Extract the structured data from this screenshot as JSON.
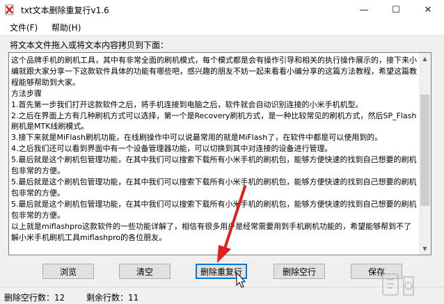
{
  "window": {
    "title": "txt文本删除重复行v1.6",
    "controls": {
      "minimize": "—",
      "maximize": "☐",
      "close": "✕"
    }
  },
  "menu": {
    "file": "文件(F)",
    "help": "帮助(H)"
  },
  "hint": "将文本文件拖入或将文本内容拷贝到下面：",
  "textarea": {
    "content": "这个品牌手机的刷机工具，其中有非常全面的刷机模式，每个模式都是会有操作引导和相关的执行操作展示的，接下来小编就跟大家分享一下这款软件具体的功能有哪些吧，感兴趣的朋友不妨一起来看看小编分享的这篇方法教程，希望这篇教程能够帮助到大家。\n方法步骤\n1.首先第一步我们打开这款软件之后，将手机连接到电脑之后，软件就会自动识别连接的小米手机机型。\n2.之后在界面上方有几种刷机方式可以选择，第一个是Recovery刷机方式，是一种比较常见的刷机方式，然后SP_Flash刷机是MTK线刷模式。\n3.接下来就是MiFlash刷机功能，在线刷操作中可以说最常用的就是MiFlash了，在软件中都是可以使用到的。\n4.之后我们还可以看到界面中有一个设备管理器功能，可以切换到其中对连接的设备进行管理。\n5.最后就是这个刷机包管理功能，在其中我们可以搜索下载所有小米手机的刷机包，能够方便快速的找到自己想要的刷机包非常的方便。\n5.最后就是这个刷机包管理功能，在其中我们可以搜索下载所有小米手机的刷机包，能够方便快速的找到自己想要的刷机包非常的方便。\n5.最后就是这个刷机包管理功能，在其中我们可以搜索下载所有小米手机的刷机包，能够方便快速的找到自己想要的刷机包非常的方便。\n以上就是miflashpro这款软件的一些功能详解了，相信有很多用户是经常需要用到手机刷机功能的，希望能够帮到不了解小米手机刷机工具miflashpro的各位朋友。"
  },
  "buttons": {
    "browse": "浏览",
    "clear": "清空",
    "dedupe": "删除重复行",
    "remove_empty": "删除空行",
    "save": "保存"
  },
  "status": {
    "deleted_empty": "删除空行数：12",
    "remaining": "剩余行数：11"
  },
  "colors": {
    "accent": "#0078d7",
    "arrow": "#e02020"
  }
}
